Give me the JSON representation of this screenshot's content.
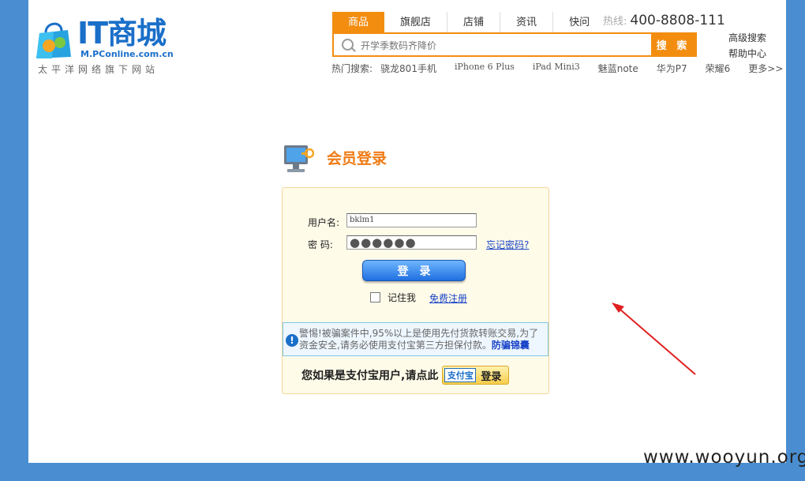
{
  "logo": {
    "title": "IT商城",
    "subtitle": "M.PConline.com.cn",
    "slogan": "太平洋网络旗下网站"
  },
  "nav": {
    "tabs": [
      "商品",
      "旗舰店",
      "店铺",
      "资讯",
      "快问"
    ],
    "hotline_label": "热线:",
    "hotline_number": "400-8808-111"
  },
  "search": {
    "placeholder": "开学季数码齐降价",
    "button": "搜 索",
    "advanced": "高级搜索",
    "help": "帮助中心"
  },
  "hot_search": {
    "label": "热门搜索:",
    "items": [
      "骁龙801手机",
      "iPhone 6 Plus",
      "iPad Mini3",
      "魅蓝note",
      "华为P7",
      "荣耀6",
      "更多>>"
    ]
  },
  "login": {
    "title": "会员登录",
    "username_label": "用户名:",
    "username_value": "bklm1",
    "password_label": "密 码:",
    "password_value": "●●●●●●",
    "forgot": "忘记密码?",
    "submit": "登录",
    "remember": "记住我",
    "register": "免费注册",
    "warning": "警惕!被骗案件中,95%以上是使用先付货款转账交易,为了资金安全,请务必使用支付宝第三方担保付款。",
    "warning_link": "防骗锦囊",
    "alipay_prompt": "您如果是支付宝用户,请点此",
    "alipay_logo": "支付宝",
    "alipay_login": "登录"
  },
  "watermark": "www.wooyun.org",
  "colors": {
    "accent": "#f38d10",
    "brand": "#1a6fc9",
    "background": "#4a8ed1"
  }
}
